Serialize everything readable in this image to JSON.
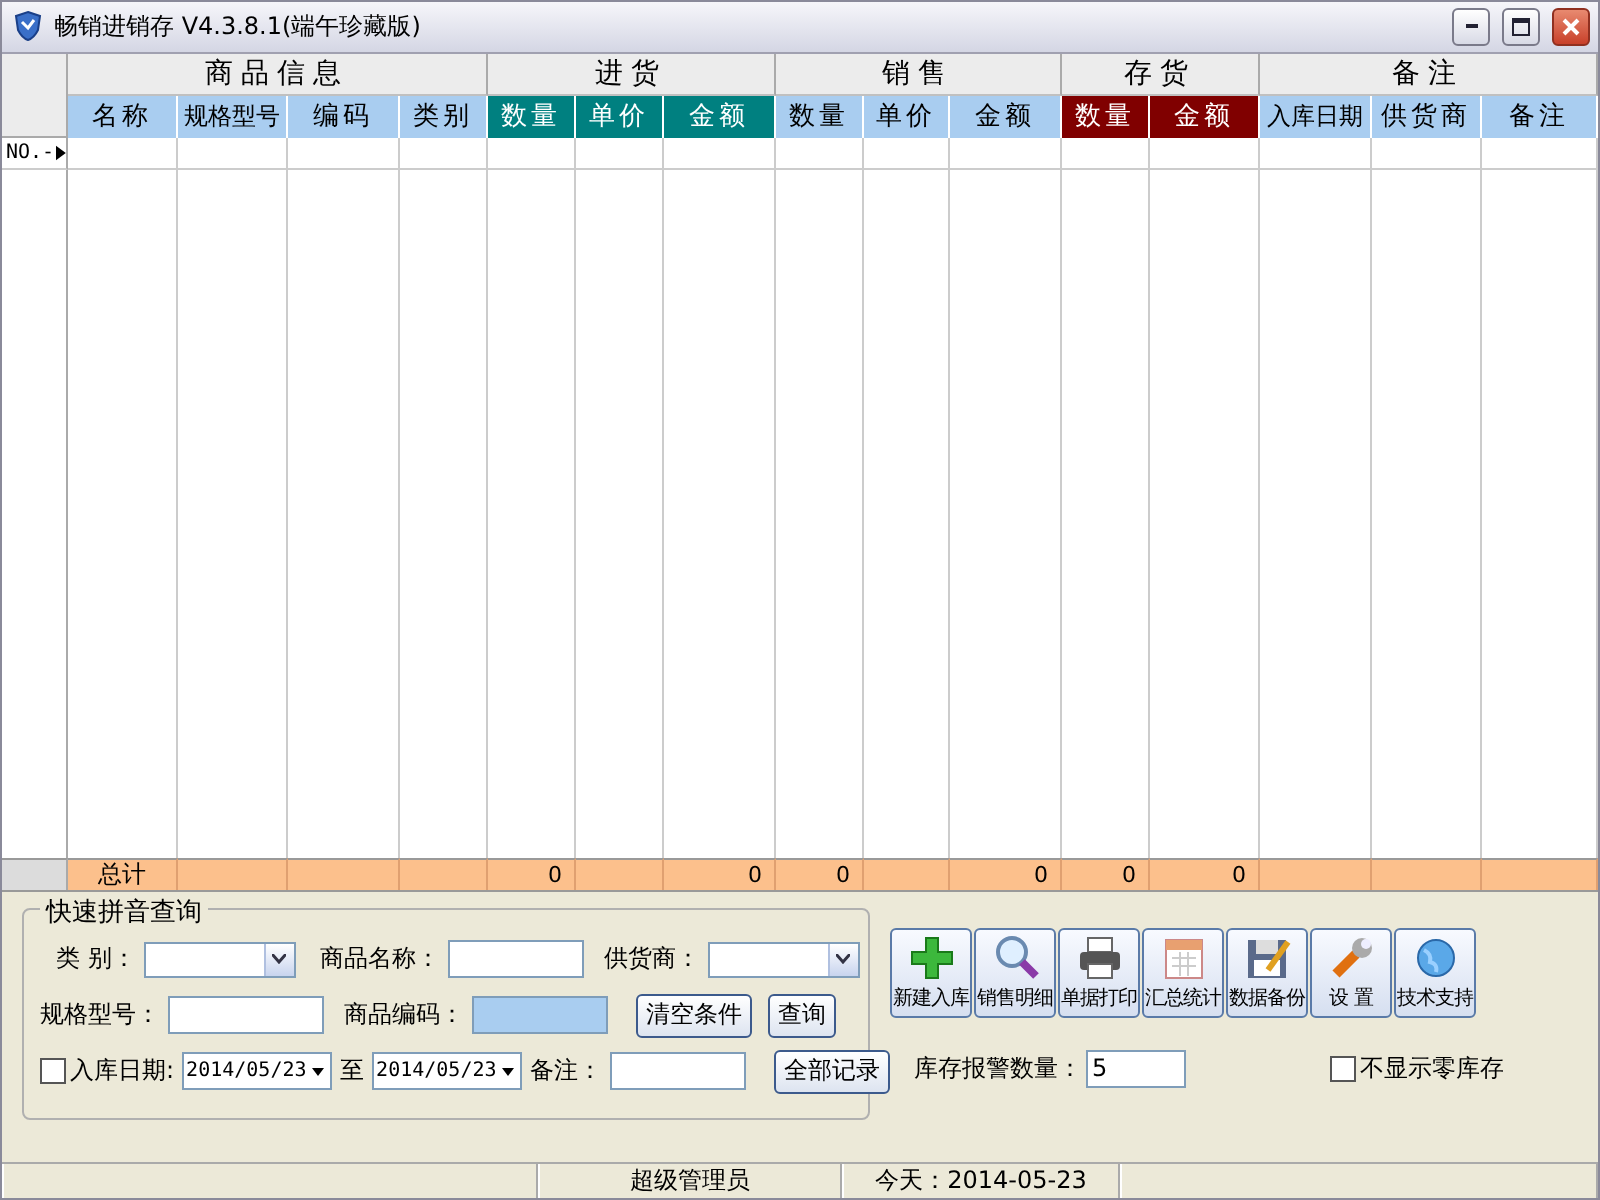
{
  "window": {
    "title": "畅销进销存 V4.3.8.1(端午珍藏版)"
  },
  "table": {
    "groups": [
      {
        "label": "商品信息",
        "columns": [
          {
            "label": "名称",
            "color": "#a9cdf0"
          },
          {
            "label": "规格型号",
            "color": "#a9cdf0"
          },
          {
            "label": "编码",
            "color": "#a9cdf0"
          },
          {
            "label": "类别",
            "color": "#a9cdf0"
          }
        ]
      },
      {
        "label": "进货",
        "columns": [
          {
            "label": "数量",
            "color": "#008080",
            "total": "0"
          },
          {
            "label": "单价",
            "color": "#008080"
          },
          {
            "label": "金额",
            "color": "#008080",
            "total": "0"
          }
        ]
      },
      {
        "label": "销售",
        "columns": [
          {
            "label": "数量",
            "color": "#a9cdf0",
            "total": "0"
          },
          {
            "label": "单价",
            "color": "#a9cdf0"
          },
          {
            "label": "金额",
            "color": "#a9cdf0",
            "total": "0"
          }
        ]
      },
      {
        "label": "存货",
        "columns": [
          {
            "label": "数量",
            "color": "#800000",
            "total": "0"
          },
          {
            "label": "金额",
            "color": "#800000",
            "total": "0"
          }
        ]
      },
      {
        "label": "备注",
        "columns": [
          {
            "label": "入库日期",
            "color": "#a9cdf0"
          },
          {
            "label": "供货商",
            "color": "#a9cdf0"
          },
          {
            "label": "备注",
            "color": "#a9cdf0"
          }
        ]
      }
    ],
    "row_header": "NO.-",
    "total_label": "总计"
  },
  "query": {
    "title": "快速拼音查询",
    "rows": [
      [
        {
          "kind": "label",
          "text": "类 别："
        },
        {
          "kind": "select"
        },
        {
          "kind": "label",
          "text": "商品名称："
        },
        {
          "kind": "input",
          "highlighted": false
        },
        {
          "kind": "label",
          "text": "供货商："
        },
        {
          "kind": "select"
        }
      ],
      [
        {
          "kind": "label",
          "text": "规格型号："
        },
        {
          "kind": "input",
          "highlighted": false
        },
        {
          "kind": "label",
          "text": "商品编码："
        },
        {
          "kind": "input",
          "highlighted": true
        },
        {
          "kind": "button",
          "text": "清空条件"
        },
        {
          "kind": "button",
          "text": "查询"
        }
      ],
      [
        {
          "kind": "checkbox",
          "text": "入库日期:",
          "checked": false
        },
        {
          "kind": "date",
          "value": "2014/05/23"
        },
        {
          "kind": "label",
          "text": "至"
        },
        {
          "kind": "date",
          "value": "2014/05/23"
        },
        {
          "kind": "label",
          "text": "备注："
        },
        {
          "kind": "input",
          "highlighted": false
        },
        {
          "kind": "button",
          "text": "全部记录"
        }
      ]
    ]
  },
  "toolbar": [
    {
      "label": "新建入库"
    },
    {
      "label": "销售明细"
    },
    {
      "label": "单据打印"
    },
    {
      "label": "汇总统计"
    },
    {
      "label": "数据备份"
    },
    {
      "label": "设 置"
    },
    {
      "label": "技术支持"
    }
  ],
  "alarm": {
    "label": "库存报警数量：",
    "value": "5"
  },
  "zero_stock": {
    "label": "不显示零库存",
    "checked": false
  },
  "status_bar": [
    "超级管理员",
    "今天：2014-05-23"
  ]
}
